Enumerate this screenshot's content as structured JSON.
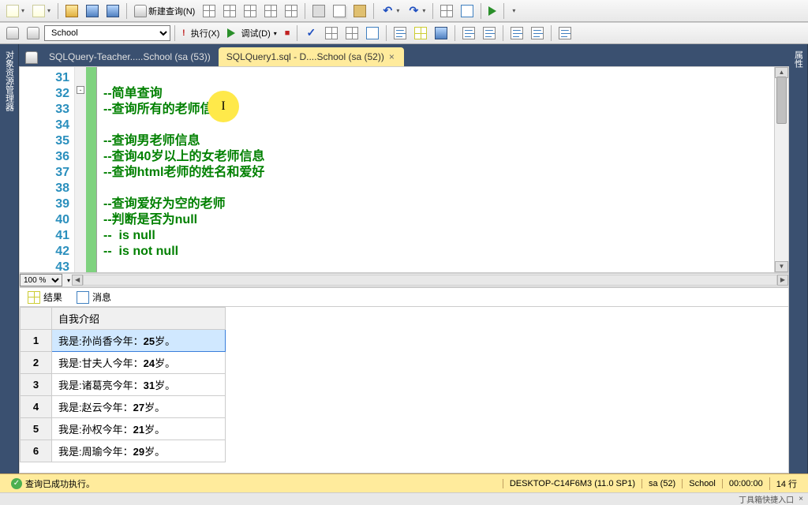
{
  "toolbar1": {
    "new_query": "新建查询(N)"
  },
  "toolbar2": {
    "database": "School",
    "execute": "执行(X)",
    "debug": "调试(D)"
  },
  "side_left": "对象资源管理器",
  "side_right": "属性",
  "tabs": [
    {
      "label": "SQLQuery-Teacher.....School (sa (53))",
      "active": false
    },
    {
      "label": "SQLQuery1.sql - D....School (sa (52))",
      "active": true
    }
  ],
  "editor": {
    "line_numbers": [
      "31",
      "32",
      "33",
      "34",
      "35",
      "36",
      "37",
      "38",
      "39",
      "40",
      "41",
      "42",
      "43"
    ],
    "lines": [
      "",
      "--简单查询",
      "--查询所有的老师信息",
      "",
      "--查询男老师信息",
      "--查询40岁以上的女老师信息",
      "--查询html老师的姓名和爱好",
      "",
      "--查询爱好为空的老师",
      "--判断是否为null",
      "--  is null",
      "--  is not null",
      ""
    ],
    "zoom": "100 %"
  },
  "results_tabs": {
    "results": "结果",
    "messages": "消息"
  },
  "results": {
    "column": "自我介绍",
    "rows": [
      {
        "n": "1",
        "text_pre": "我是:孙尚香今年：",
        "age": "25",
        "text_post": "岁。"
      },
      {
        "n": "2",
        "text_pre": "我是:甘夫人今年：",
        "age": "24",
        "text_post": "岁。"
      },
      {
        "n": "3",
        "text_pre": "我是:诸葛亮今年：",
        "age": "31",
        "text_post": "岁。"
      },
      {
        "n": "4",
        "text_pre": "我是:赵云今年：",
        "age": "27",
        "text_post": "岁。"
      },
      {
        "n": "5",
        "text_pre": "我是:孙权今年：",
        "age": "21",
        "text_post": "岁。"
      },
      {
        "n": "6",
        "text_pre": "我是:周瑜今年：",
        "age": "29",
        "text_post": "岁。"
      }
    ]
  },
  "status": {
    "message": "查询已成功执行。",
    "server": "DESKTOP-C14F6M3 (11.0 SP1)",
    "user": "sa (52)",
    "db": "School",
    "time": "00:00:00",
    "rows": "14 行"
  },
  "footer": {
    "text": "丁具箱快捷入口"
  }
}
